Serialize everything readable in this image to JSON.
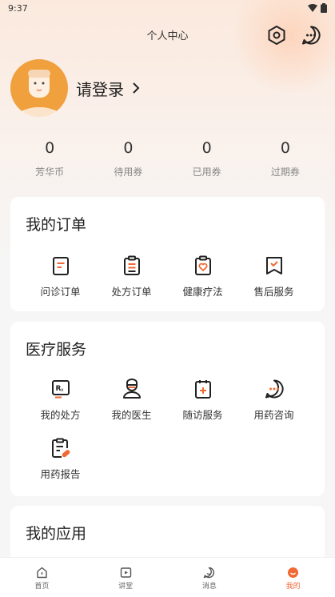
{
  "status_bar": {
    "time": "9:37"
  },
  "header": {
    "title": "个人中心"
  },
  "profile": {
    "login_label": "请登录"
  },
  "stats": [
    {
      "value": "0",
      "label": "芳华币"
    },
    {
      "value": "0",
      "label": "待用券"
    },
    {
      "value": "0",
      "label": "已用券"
    },
    {
      "value": "0",
      "label": "过期券"
    }
  ],
  "orders": {
    "title": "我的订单",
    "items": [
      {
        "label": "问诊订单",
        "icon": "consult-order-icon"
      },
      {
        "label": "处方订单",
        "icon": "prescription-order-icon"
      },
      {
        "label": "健康疗法",
        "icon": "health-therapy-icon"
      },
      {
        "label": "售后服务",
        "icon": "after-sales-icon"
      }
    ]
  },
  "medical": {
    "title": "医疗服务",
    "items": [
      {
        "label": "我的处方",
        "icon": "rx-icon"
      },
      {
        "label": "我的医生",
        "icon": "doctor-icon"
      },
      {
        "label": "随访服务",
        "icon": "follow-up-icon"
      },
      {
        "label": "用药咨询",
        "icon": "chat-bubble-icon"
      },
      {
        "label": "用药报告",
        "icon": "medication-report-icon"
      }
    ]
  },
  "apps": {
    "title": "我的应用"
  },
  "tabbar": [
    {
      "label": "首页",
      "icon": "home-icon"
    },
    {
      "label": "讲堂",
      "icon": "video-icon"
    },
    {
      "label": "消息",
      "icon": "message-icon"
    },
    {
      "label": "我的",
      "icon": "profile-smile-icon"
    }
  ],
  "colors": {
    "accent": "#f06a35",
    "avatar_bg": "#f0a03c",
    "icon_stroke": "#222222"
  }
}
